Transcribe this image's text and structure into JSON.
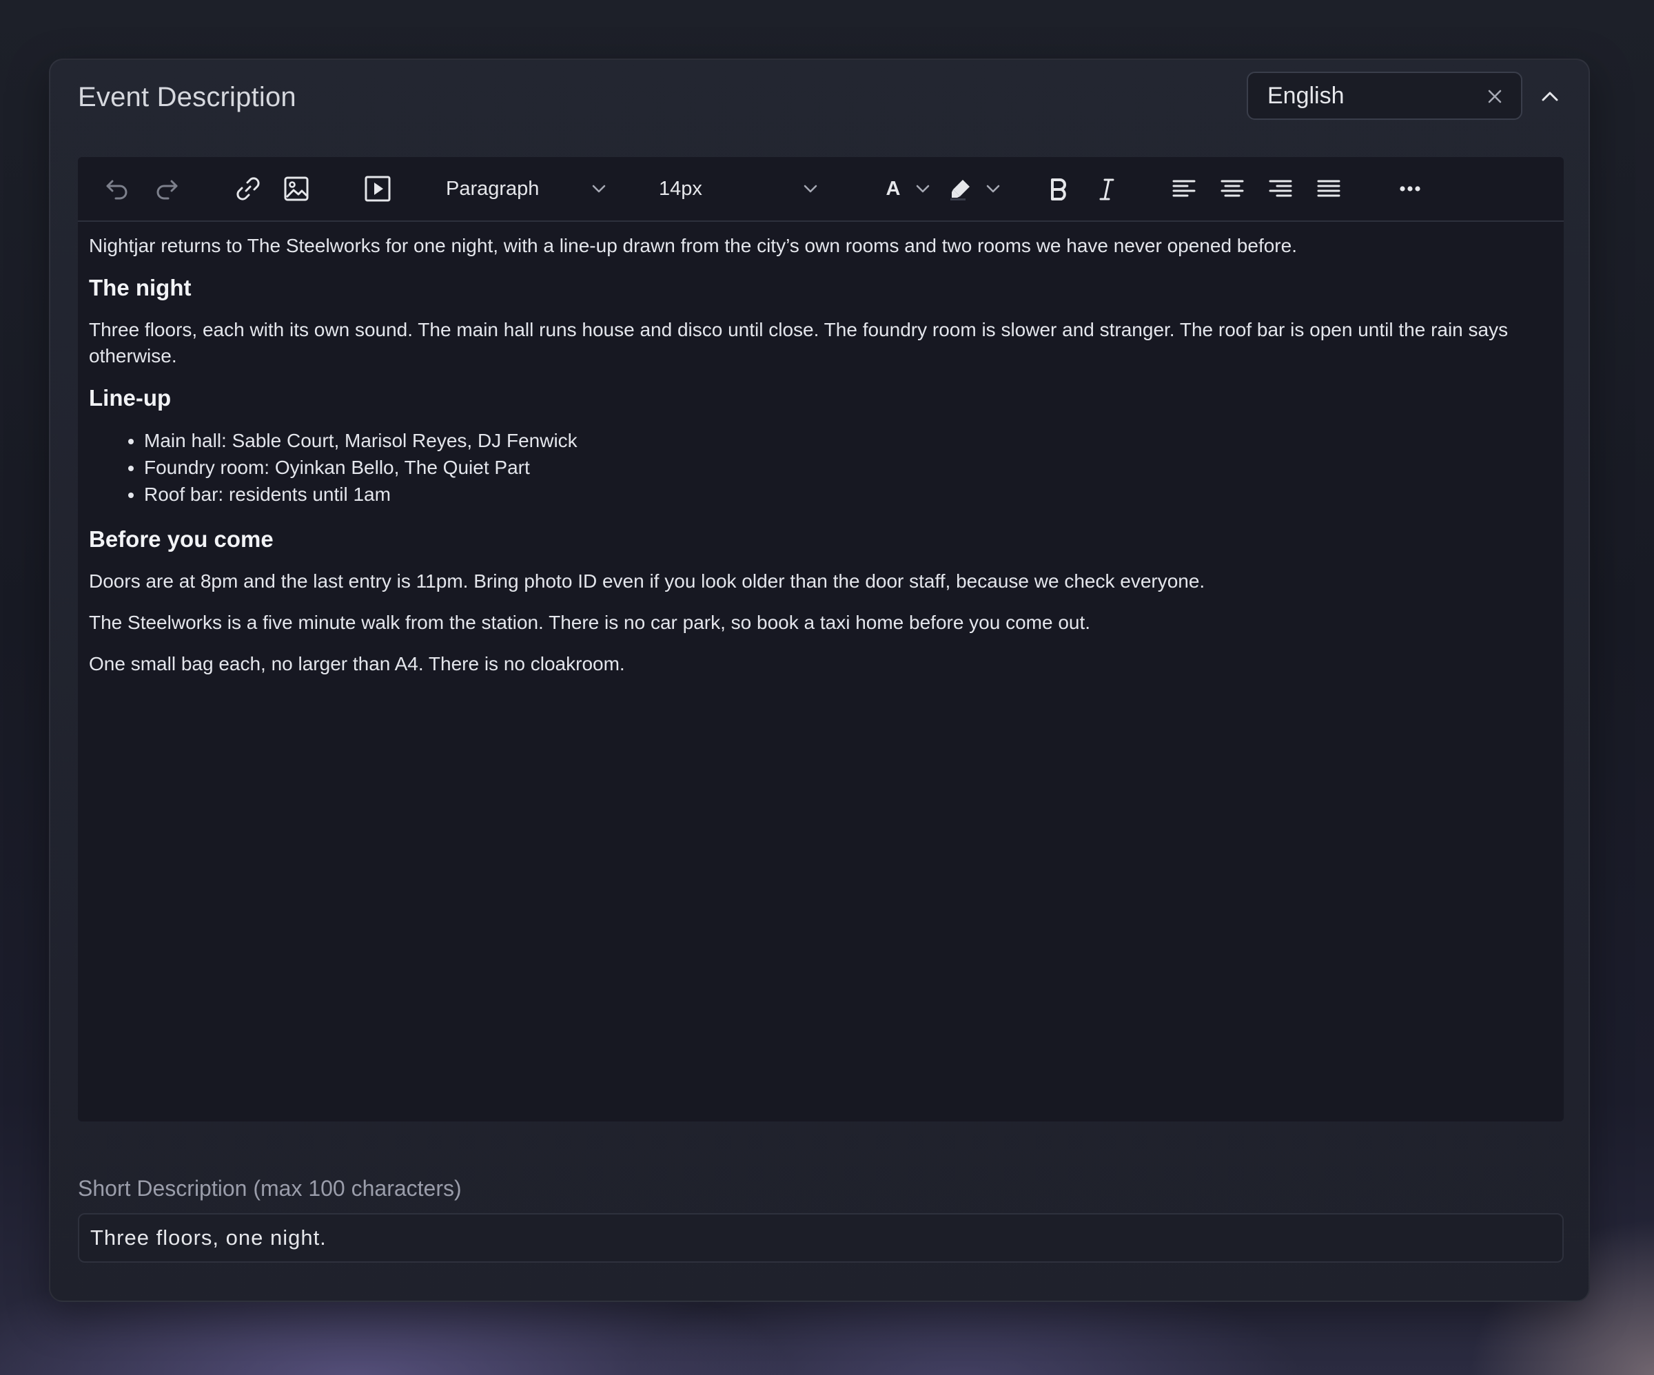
{
  "card": {
    "title": "Event Description"
  },
  "language": {
    "selected": "English"
  },
  "toolbar": {
    "block_format": "Paragraph",
    "font_size": "14px",
    "text_color_glyph": "A",
    "icons": [
      "undo-icon",
      "redo-icon",
      "link-icon",
      "image-icon",
      "video-icon",
      "text-color-icon",
      "highlight-icon",
      "bold-icon",
      "italic-icon",
      "align-left-icon",
      "align-center-icon",
      "align-right-icon",
      "align-justify-icon",
      "more-icon"
    ]
  },
  "content": {
    "intro": "Nightjar returns to The Steelworks for one night, with a line-up drawn from the city’s own rooms and two rooms we have never opened before.",
    "night_heading": "The night",
    "night_text": "Three floors, each with its own sound. The main hall runs house and disco until close. The foundry room is slower and stranger. The roof bar is open until the rain says otherwise.",
    "lineup_heading": "Line-up",
    "lineup": [
      "Main hall: Sable Court, Marisol Reyes, DJ Fenwick",
      "Foundry room: Oyinkan Bello, The Quiet Part",
      "Roof bar: residents until 1am"
    ],
    "before_heading": "Before you come",
    "before_paragraphs": [
      "Doors are at 8pm and the last entry is 11pm. Bring photo ID even if you look older than the door staff, because we check everyone.",
      "The Steelworks is a five minute walk from the station. There is no car park, so book a taxi home before you come out.",
      "One small bag each, no larger than A4. There is no cloakroom."
    ]
  },
  "short_description": {
    "label": "Short Description (max 100 characters)",
    "value": "Three floors, one night."
  }
}
